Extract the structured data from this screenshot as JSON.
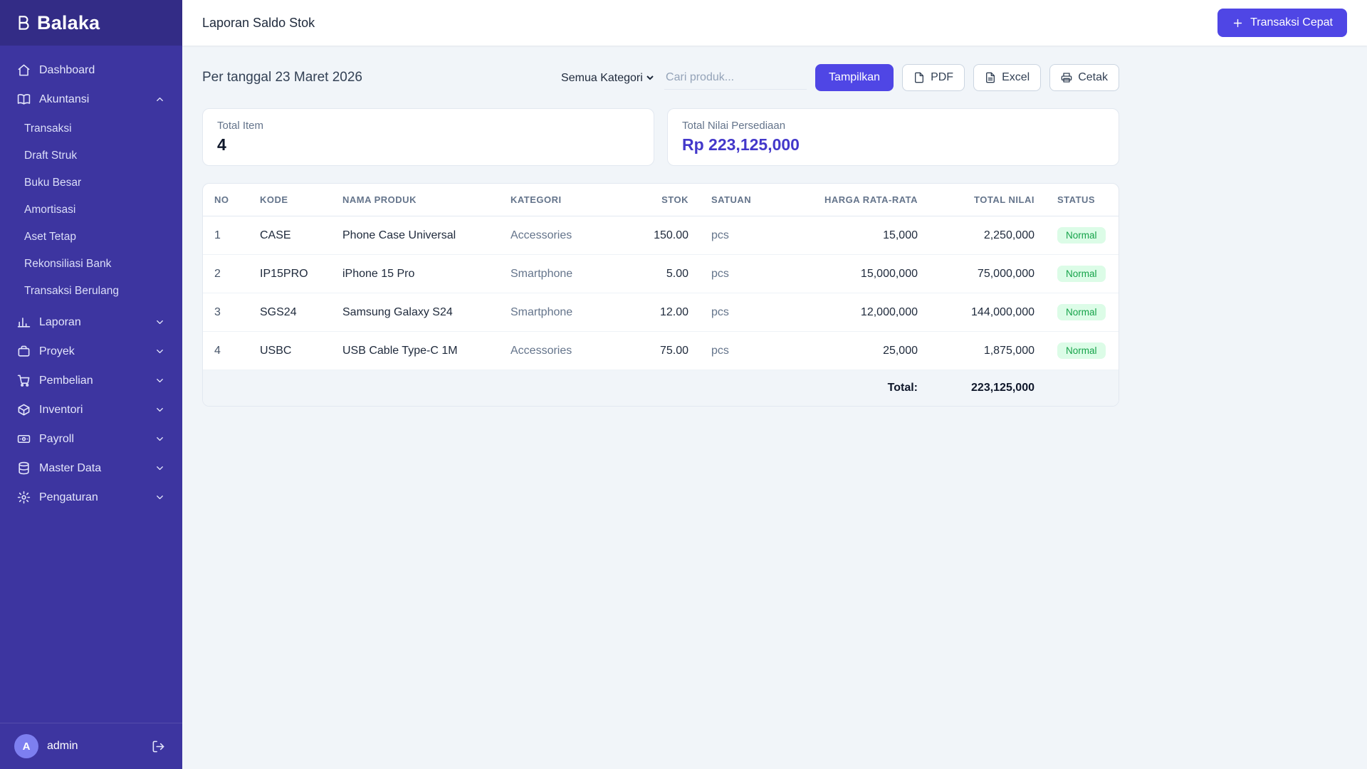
{
  "colors": {
    "sidebar-bg": "#3d35a0",
    "sidebar-dark": "#332c86",
    "accent": "#4f46e5",
    "accent-dark": "#4338ca",
    "badge-bg": "#dcfce7",
    "badge-text": "#16a34a",
    "page-bg": "#f1f5f9"
  },
  "app": {
    "name": "Balaka"
  },
  "sidebar": {
    "items": [
      {
        "label": "Dashboard",
        "icon": "home-icon"
      },
      {
        "label": "Akuntansi",
        "icon": "book-icon",
        "expanded": true,
        "children": [
          {
            "label": "Transaksi"
          },
          {
            "label": "Draft Struk"
          },
          {
            "label": "Buku Besar"
          },
          {
            "label": "Amortisasi"
          },
          {
            "label": "Aset Tetap"
          },
          {
            "label": "Rekonsiliasi Bank"
          },
          {
            "label": "Transaksi Berulang"
          }
        ]
      },
      {
        "label": "Laporan",
        "icon": "chart-icon"
      },
      {
        "label": "Proyek",
        "icon": "briefcase-icon"
      },
      {
        "label": "Pembelian",
        "icon": "cart-icon"
      },
      {
        "label": "Inventori",
        "icon": "box-icon"
      },
      {
        "label": "Payroll",
        "icon": "banknote-icon"
      },
      {
        "label": "Master Data",
        "icon": "database-icon"
      },
      {
        "label": "Pengaturan",
        "icon": "gear-icon"
      }
    ],
    "user": {
      "initial": "A",
      "name": "admin"
    }
  },
  "header": {
    "title": "Laporan Saldo Stok",
    "quick_action": "Transaksi Cepat"
  },
  "content": {
    "date_heading": "Per tanggal 23 Maret 2026",
    "filters": {
      "category": "Semua Kategori",
      "search_placeholder": "Cari produk...",
      "submit": "Tampilkan",
      "pdf": "PDF",
      "excel": "Excel",
      "print": "Cetak"
    },
    "summary": [
      {
        "label": "Total Item",
        "value": "4"
      },
      {
        "label": "Total Nilai Persediaan",
        "value": "Rp 223,125,000"
      }
    ],
    "table": {
      "headers": [
        "NO",
        "KODE",
        "NAMA PRODUK",
        "KATEGORI",
        "STOK",
        "SATUAN",
        "HARGA RATA-RATA",
        "TOTAL NILAI",
        "STATUS"
      ],
      "rows": [
        {
          "no": "1",
          "kode": "CASE",
          "nama": "Phone Case Universal",
          "kategori": "Accessories",
          "stok": "150.00",
          "satuan": "pcs",
          "harga": "15,000",
          "total": "2,250,000",
          "status": "Normal"
        },
        {
          "no": "2",
          "kode": "IP15PRO",
          "nama": "iPhone 15 Pro",
          "kategori": "Smartphone",
          "stok": "5.00",
          "satuan": "pcs",
          "harga": "15,000,000",
          "total": "75,000,000",
          "status": "Normal"
        },
        {
          "no": "3",
          "kode": "SGS24",
          "nama": "Samsung Galaxy S24",
          "kategori": "Smartphone",
          "stok": "12.00",
          "satuan": "pcs",
          "harga": "12,000,000",
          "total": "144,000,000",
          "status": "Normal"
        },
        {
          "no": "4",
          "kode": "USBC",
          "nama": "USB Cable Type-C 1M",
          "kategori": "Accessories",
          "stok": "75.00",
          "satuan": "pcs",
          "harga": "25,000",
          "total": "1,875,000",
          "status": "Normal"
        }
      ],
      "footer": {
        "label": "Total:",
        "value": "223,125,000"
      }
    }
  }
}
